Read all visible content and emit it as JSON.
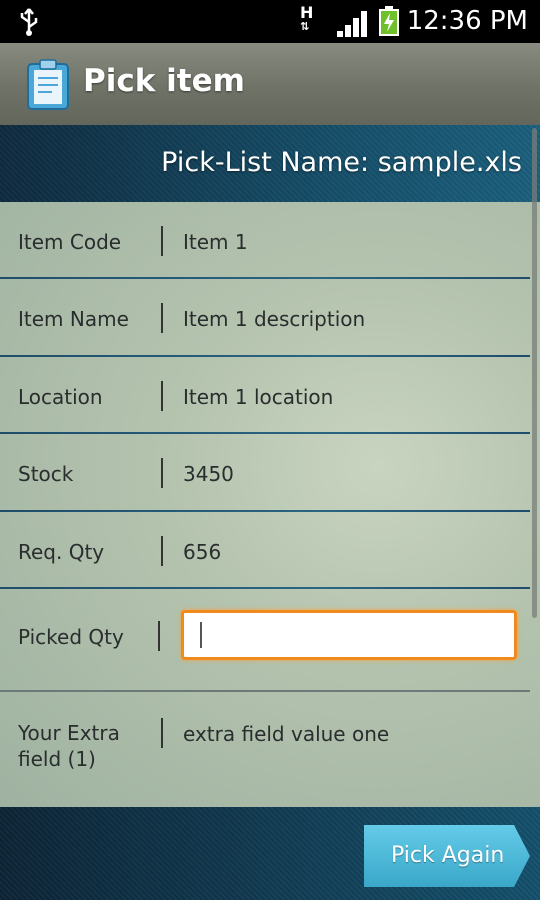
{
  "status_bar": {
    "network": "H",
    "time": "12:36 PM",
    "icons": [
      "usb-icon",
      "data-arrows-icon",
      "signal-icon",
      "battery-charging-icon"
    ]
  },
  "action_bar": {
    "title": "Pick item",
    "icon": "clipboard-app-icon"
  },
  "header": {
    "picklist_label": "Pick-List Name: sample.xls"
  },
  "rows": [
    {
      "label": "Item Code",
      "value": "Item 1"
    },
    {
      "label": "Item Name",
      "value": "Item 1 description"
    },
    {
      "label": "Location",
      "value": "Item 1 location"
    },
    {
      "label": "Stock",
      "value": "3450"
    },
    {
      "label": "Req. Qty",
      "value": "656"
    }
  ],
  "picked_qty": {
    "label": "Picked Qty",
    "value": ""
  },
  "extra_field": {
    "label": "Your Extra field (1)",
    "value": "extra field value one"
  },
  "footer": {
    "pick_again_label": "Pick Again"
  },
  "colors": {
    "accent_orange": "#f08a1c",
    "button_blue": "#4ab6d6",
    "header_blue": "#154d68"
  }
}
